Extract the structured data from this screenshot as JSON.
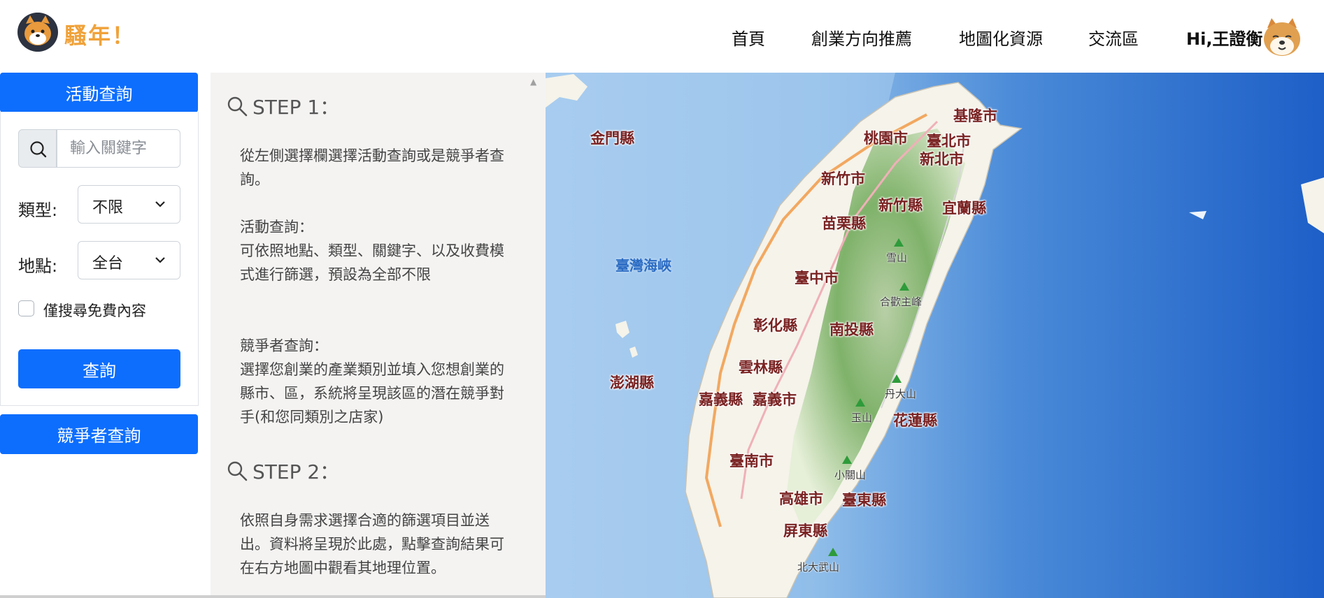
{
  "header": {
    "brand": "騷年！",
    "nav": [
      "首頁",
      "創業方向推薦",
      "地圖化資源",
      "交流區"
    ],
    "user": "Hi,王證衡"
  },
  "sidebar": {
    "activity_query": "活動查詢",
    "search_placeholder": "輸入關鍵字",
    "type_label": "類型:",
    "type_value": "不限",
    "location_label": "地點:",
    "location_value": "全台",
    "free_only_label": "僅搜尋免費內容",
    "query_button": "查詢",
    "competitor_query": "競爭者查詢"
  },
  "instructions": {
    "step1_title": "STEP 1：",
    "step1_text": "從左側選擇欄選擇活動查詢或是競爭者查詢。",
    "activity_title": "活動查詢：",
    "activity_text": "可依照地點、類型、關鍵字、以及收費模式進行篩選，預設為全部不限",
    "competitor_title": "競爭者查詢：",
    "competitor_text": "選擇您創業的產業類別並填入您想創業的縣市、區，系統將呈現該區的潛在競爭對手(和您同類別之店家)",
    "step2_title": "STEP 2：",
    "step2_text": "依照自身需求選擇合適的篩選項目並送出。資料將呈現於此處，點擊查詢結果可在右方地圖中觀看其地理位置。"
  },
  "map": {
    "sea": "臺灣海峽",
    "places": [
      "基隆市",
      "金門縣",
      "桃園市",
      "臺北市",
      "新北市",
      "新竹市",
      "新竹縣",
      "宜蘭縣",
      "苗栗縣",
      "臺中市",
      "彰化縣",
      "南投縣",
      "雲林縣",
      "澎湖縣",
      "嘉義縣",
      "嘉義市",
      "花蓮縣",
      "臺南市",
      "高雄市",
      "臺東縣",
      "屏東縣"
    ],
    "peaks": [
      "雪山",
      "合歡主峰",
      "丹大山",
      "玉山",
      "小關山",
      "北大武山"
    ]
  }
}
